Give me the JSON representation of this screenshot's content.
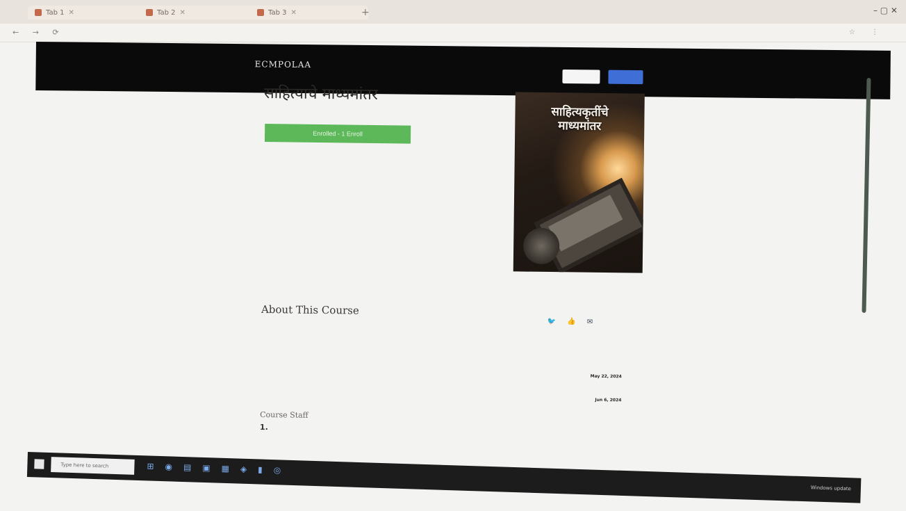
{
  "browser": {
    "tabs": [
      {
        "label": "Tab 1"
      },
      {
        "label": "Tab 2"
      },
      {
        "label": "Tab 3"
      }
    ],
    "new_tab": "+",
    "window_controls": "– ▢ ✕",
    "nav": "← → ⟳",
    "url": "",
    "extensions": "☆ ⋮"
  },
  "header": {
    "brand": "ECMPOLAA",
    "subtitle_line1": "",
    "subtitle_line2": "",
    "button_light": "",
    "button_blue": ""
  },
  "course": {
    "title": "साहित्याचे माध्यमांतर",
    "subtitle": "",
    "enroll_button": "Enrolled - 1 Enroll",
    "cover_title_line1": "साहित्यकृतींचे",
    "cover_title_line2": "माध्यमांतर"
  },
  "about": {
    "title": "About This Course",
    "body": "",
    "staff_title": "Course Staff",
    "staff_number": "1.",
    "staff_name": ""
  },
  "sidebar": {
    "social_icons": [
      "twitter-icon",
      "facebook-icon",
      "email-icon"
    ],
    "social_glyphs": [
      "🐦",
      "👍",
      "✉"
    ],
    "meta": [
      {
        "label": "",
        "value": ""
      },
      {
        "label": "",
        "value": "May 22, 2024"
      },
      {
        "label": "",
        "value": "Jun 6, 2024"
      }
    ]
  },
  "taskbar": {
    "search_placeholder": "Type here to search",
    "icons": [
      "⊞",
      "◉",
      "▤",
      "▣",
      "▦",
      "◈",
      "▮",
      "◎"
    ],
    "tray": "Windows update"
  },
  "colors": {
    "header_bg": "#0a0a0a",
    "enroll_green": "#5db85a",
    "header_blue_button": "#3f6fd6",
    "body_text_red": "#b05a5a"
  }
}
